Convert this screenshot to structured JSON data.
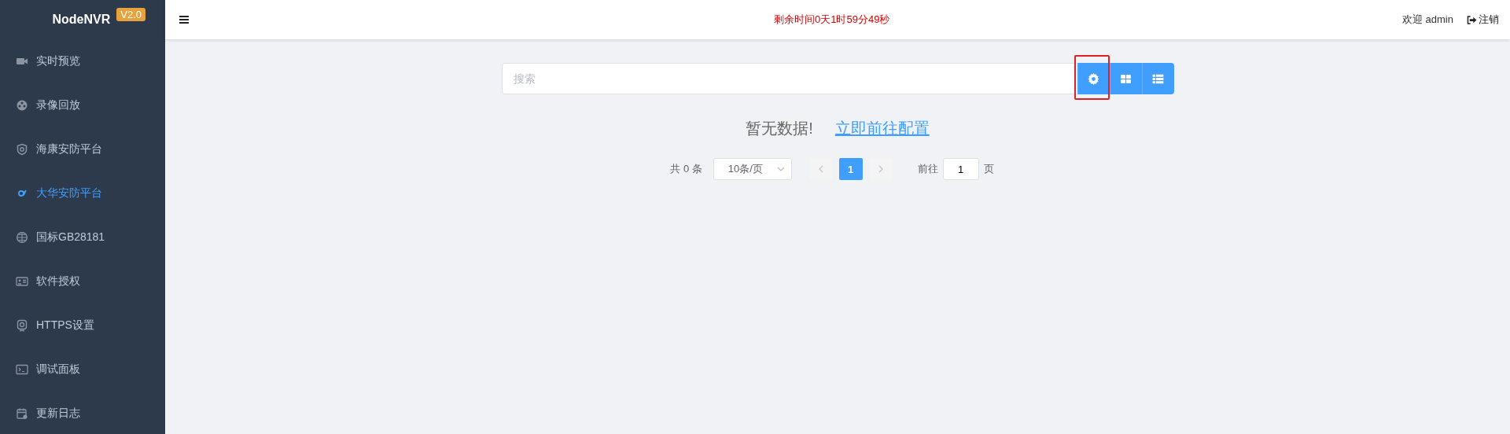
{
  "sidebar": {
    "logo": "NodeNVR",
    "version": "V2.0",
    "items": [
      {
        "label": "实时预览",
        "selected": false
      },
      {
        "label": "录像回放",
        "selected": false
      },
      {
        "label": "海康安防平台",
        "selected": false
      },
      {
        "label": "大华安防平台",
        "selected": true
      },
      {
        "label": "国标GB28181",
        "selected": false
      },
      {
        "label": "软件授权",
        "selected": false
      },
      {
        "label": "HTTPS设置",
        "selected": false
      },
      {
        "label": "调试面板",
        "selected": false
      },
      {
        "label": "更新日志",
        "selected": false
      }
    ]
  },
  "header": {
    "countdown": "剩余时间0天1时59分49秒",
    "welcome": "欢迎 admin",
    "logout": "注销"
  },
  "toolbar": {
    "search": {
      "placeholder": "搜索"
    },
    "buttons": [
      {
        "highlighted": true
      },
      {
        "highlighted": false
      },
      {
        "highlighted": false
      }
    ]
  },
  "empty": {
    "message": "暂无数据!",
    "link": "立即前往配置"
  },
  "pagination": {
    "total": "共 0 条",
    "page_size": "10条/页",
    "pages": [
      {
        "label": "1",
        "selected": true
      }
    ],
    "goto_label": "前往",
    "goto_value": "1",
    "goto_suffix": "页"
  }
}
